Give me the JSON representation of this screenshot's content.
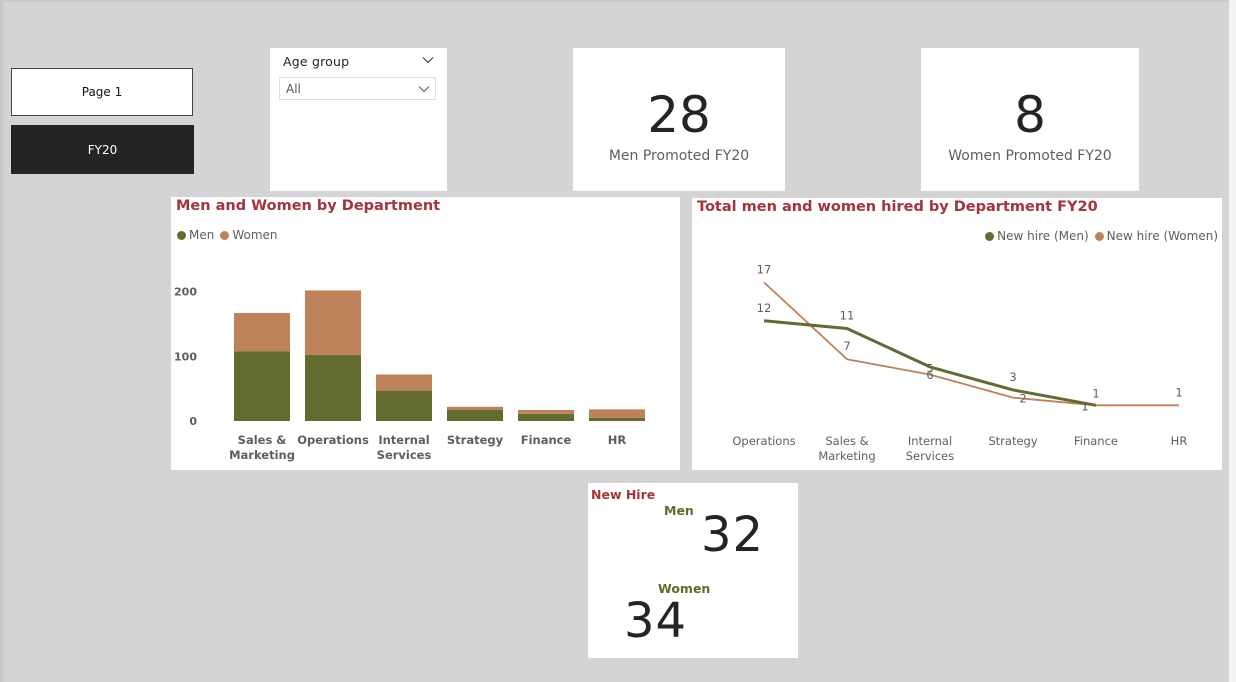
{
  "nav": {
    "page1_label": "Page 1",
    "fy20_label": "FY20"
  },
  "slicer": {
    "title": "Age group",
    "selected": "All"
  },
  "kpis": {
    "men_promoted": {
      "value": "28",
      "label": "Men Promoted FY20"
    },
    "women_promoted": {
      "value": "8",
      "label": "Women Promoted FY20"
    }
  },
  "new_hire": {
    "title": "New Hire",
    "men_label": "Men",
    "men_value": "32",
    "women_label": "Women",
    "women_value": "34"
  },
  "colors": {
    "men": "#636b2f",
    "women": "#bd825a",
    "title": "#a4343a"
  },
  "chart_data": [
    {
      "type": "bar",
      "stacked": true,
      "title": "Men and Women by Department",
      "categories": [
        "Sales & Marketing",
        "Operations",
        "Internal Services",
        "Strategy",
        "Finance",
        "HR"
      ],
      "category_lines": [
        [
          "Sales &",
          "Marketing"
        ],
        [
          "Operations"
        ],
        [
          "Internal",
          "Services"
        ],
        [
          "Strategy"
        ],
        [
          "Finance"
        ],
        [
          "HR"
        ]
      ],
      "series": [
        {
          "name": "Men",
          "color": "#636b2f",
          "values": [
            108,
            102,
            47,
            17,
            11,
            5
          ]
        },
        {
          "name": "Women",
          "color": "#bd825a",
          "values": [
            59,
            100,
            25,
            5,
            6,
            13
          ]
        }
      ],
      "yticks": [
        0,
        100,
        200
      ],
      "ylim": [
        0,
        215
      ],
      "legend": "top-left",
      "grid": false
    },
    {
      "type": "line",
      "title": "Total men and women hired by Department FY20",
      "categories": [
        "Operations",
        "Sales & Marketing",
        "Internal Services",
        "Strategy",
        "Finance",
        "HR"
      ],
      "category_lines": [
        [
          "Operations"
        ],
        [
          "Sales &",
          "Marketing"
        ],
        [
          "Internal",
          "Services"
        ],
        [
          "Strategy"
        ],
        [
          "Finance"
        ],
        [
          "HR"
        ]
      ],
      "series": [
        {
          "name": "New hire (Men)",
          "color": "#636b2f",
          "values": [
            12,
            11,
            6,
            3,
            1,
            null
          ]
        },
        {
          "name": "New hire (Women)",
          "color": "#bd825a",
          "values": [
            17,
            7,
            5,
            2,
            1,
            1
          ]
        }
      ],
      "ylim": [
        0,
        19
      ],
      "legend": "top-right",
      "grid": false
    }
  ]
}
